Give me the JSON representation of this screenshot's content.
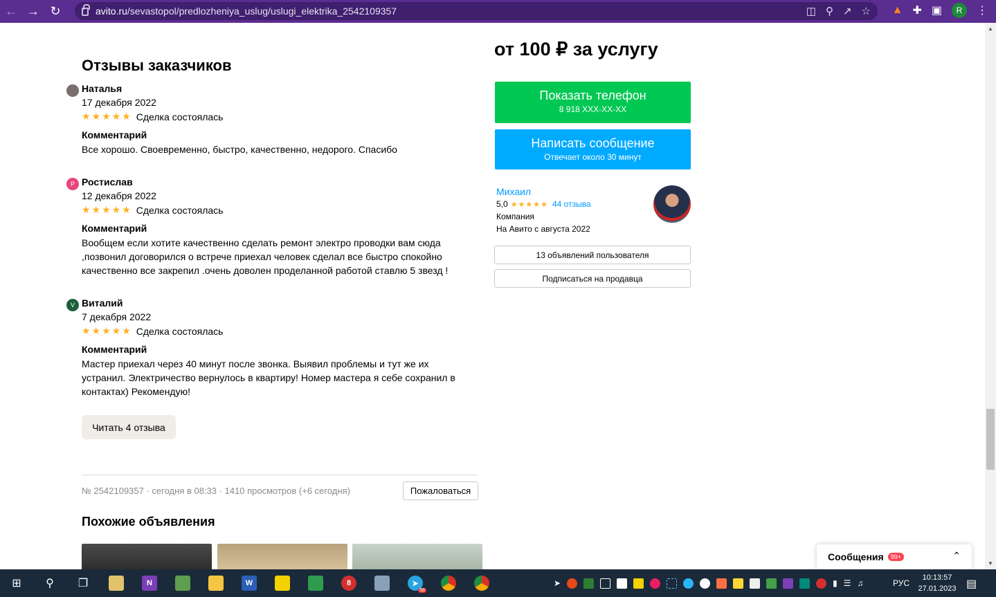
{
  "browser": {
    "url_host": "avito.ru",
    "url_path": "/sevastopol/predlozheniya_uslug/uslugi_elektrika_2542109357",
    "profile_initial": "R"
  },
  "reviews": {
    "title": "Отзывы заказчиков",
    "comment_label": "Комментарий",
    "deal_text": "Сделка состоялась",
    "stars": "★★★★★",
    "items": [
      {
        "initial": "",
        "name": "Наталья",
        "date": "17 декабря 2022",
        "text": "Все хорошо. Своевременно, быстро, качественно, недорого. Спасибо"
      },
      {
        "initial": "Р",
        "name": "Ростислав",
        "date": "12 декабря 2022",
        "text": "Вообщем если хотите качественно сделать ремонт электро проводки вам сюда ,позвонил договорился о встрече приехал человек сделал все быстро спокойно качественно все закрепил .очень доволен проделанной работой ставлю 5 звезд !"
      },
      {
        "initial": "V",
        "name": "Виталий",
        "date": "7 декабря 2022",
        "text": "Мастер приехал через 40 минут после звонка. Выявил проблемы и тут же их устранил. Электричество вернулось в квартиру! Номер мастера я себе сохранил в контактах) Рекомендую!"
      }
    ],
    "read_more": "Читать 4 отзыва"
  },
  "listing": {
    "meta": "№ 2542109357 · сегодня в 08:33 · 1410 просмотров (+6 сегодня)",
    "complain": "Пожаловаться",
    "similar_title": "Похожие объявления"
  },
  "sidebar": {
    "price": "от 100 ₽ за услугу",
    "phone_btn": "Показать телефон",
    "phone_number": "8 918 XXX-XX-XX",
    "msg_btn": "Написать сообщение",
    "msg_sub": "Отвечает около 30 минут",
    "seller_name": "Михаил",
    "seller_rating": "5,0",
    "seller_stars": "★★★★★",
    "seller_reviews": "44 отзыва",
    "seller_type": "Компания",
    "seller_since": "На Авито с августа 2022",
    "ads_btn": "13 объявлений пользователя",
    "subscribe_btn": "Подписаться на продавца"
  },
  "messages": {
    "label": "Сообщения",
    "badge": "99+"
  },
  "taskbar": {
    "telegram_badge": "58",
    "lang": "РУС",
    "time": "10:13:57",
    "date": "27.01.2023"
  },
  "colors": {
    "chrome": "#5a2d91",
    "green": "#00c853",
    "blue": "#00aaff",
    "star": "#ffb021",
    "link": "#0099ff"
  }
}
